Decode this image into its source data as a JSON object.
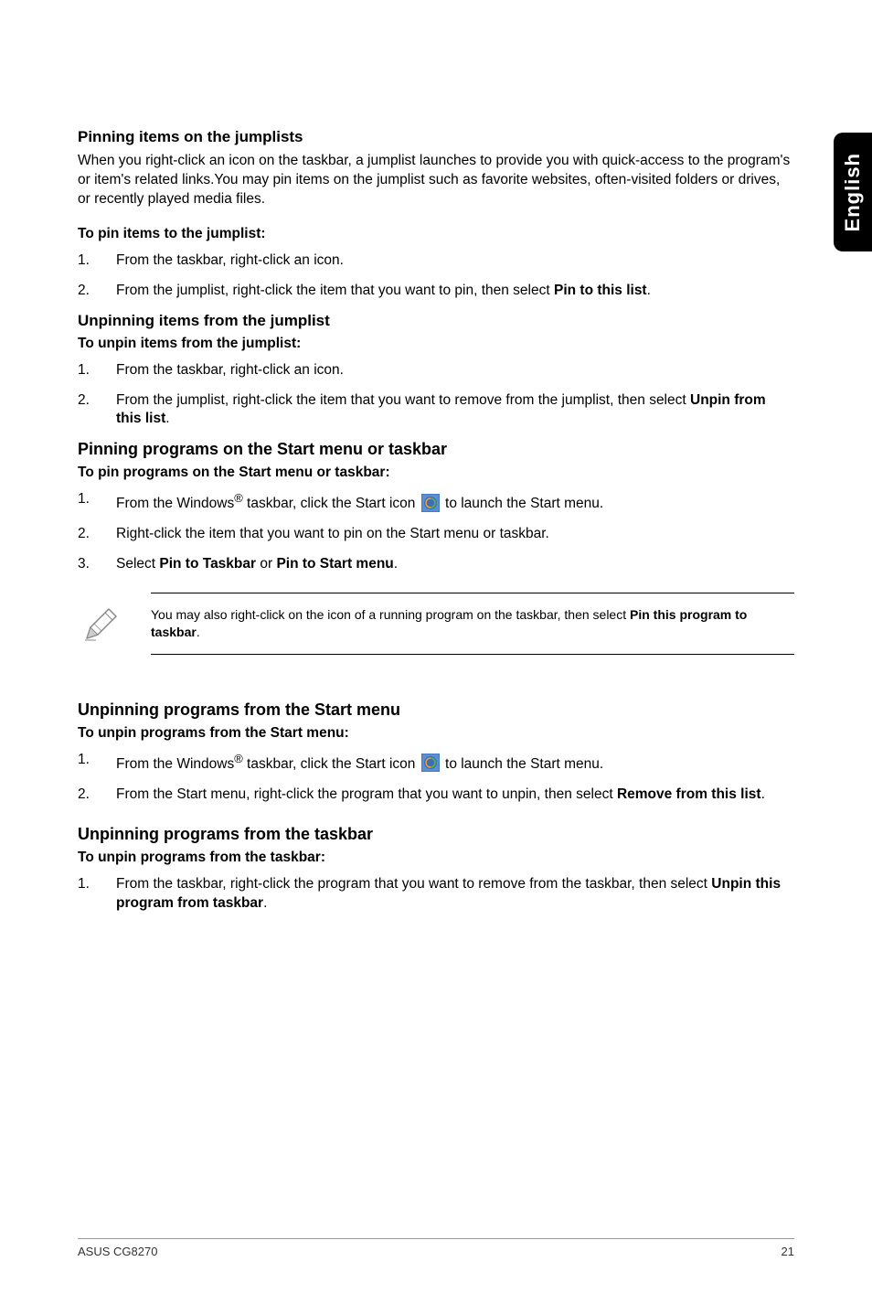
{
  "side_tab": "English",
  "s1": {
    "heading": "Pinning items on the jumplists",
    "intro": "When you right-click an icon on the taskbar, a jumplist launches to provide you with quick-access to the program's or item's related links.You may pin items on the jumplist such as favorite websites, often-visited folders or drives, or recently played media files.",
    "sub": "To pin items to the jumplist:",
    "i1_num": "1.",
    "i1_txt": "From the taskbar, right-click an icon.",
    "i2_num": "2.",
    "i2_pre": "From the jumplist, right-click the item that you want to pin, then select ",
    "i2_bold": "Pin to this list",
    "i2_post": "."
  },
  "s2": {
    "heading": "Unpinning items from the jumplist",
    "sub": "To unpin items from the jumplist:",
    "i1_num": "1.",
    "i1_txt": "From the taskbar, right-click an icon.",
    "i2_num": "2.",
    "i2_pre": "From the jumplist, right-click the item that you want to remove from the jumplist, then select ",
    "i2_bold": "Unpin from this list",
    "i2_post": "."
  },
  "s3": {
    "heading": "Pinning programs on the Start menu or taskbar",
    "sub": "To pin programs on the Start menu or taskbar:",
    "i1_num": "1.",
    "i1_pre": "From the Windows",
    "i1_reg": "®",
    "i1_mid": " taskbar, click the Start icon ",
    "i1_post": " to launch the Start menu.",
    "i2_num": "2.",
    "i2_txt": "Right-click the item that you want to pin on the Start menu or taskbar.",
    "i3_num": "3.",
    "i3_pre": "Select ",
    "i3_b1": "Pin to Taskbar",
    "i3_mid": " or ",
    "i3_b2": "Pin to Start menu",
    "i3_post": "."
  },
  "note": {
    "pre": "You may also right-click on the icon of a running program on the taskbar, then select ",
    "bold": "Pin this program to taskbar",
    "post": "."
  },
  "s4": {
    "heading": "Unpinning programs from the Start menu",
    "sub": "To unpin programs from the Start menu:",
    "i1_num": "1.",
    "i1_pre": "From the Windows",
    "i1_reg": "®",
    "i1_mid": " taskbar, click the Start icon ",
    "i1_post": " to launch the Start menu.",
    "i2_num": "2.",
    "i2_pre": "From the Start menu, right-click the program that you want to unpin, then select ",
    "i2_bold": "Remove from this list",
    "i2_post": "."
  },
  "s5": {
    "heading": "Unpinning programs from the taskbar",
    "sub": "To unpin programs from the taskbar:",
    "i1_num": "1.",
    "i1_pre": "From the taskbar, right-click the program that you want to remove from the taskbar, then select ",
    "i1_bold": "Unpin this program from taskbar",
    "i1_post": "."
  },
  "footer": {
    "left": "ASUS CG8270",
    "right": "21"
  }
}
